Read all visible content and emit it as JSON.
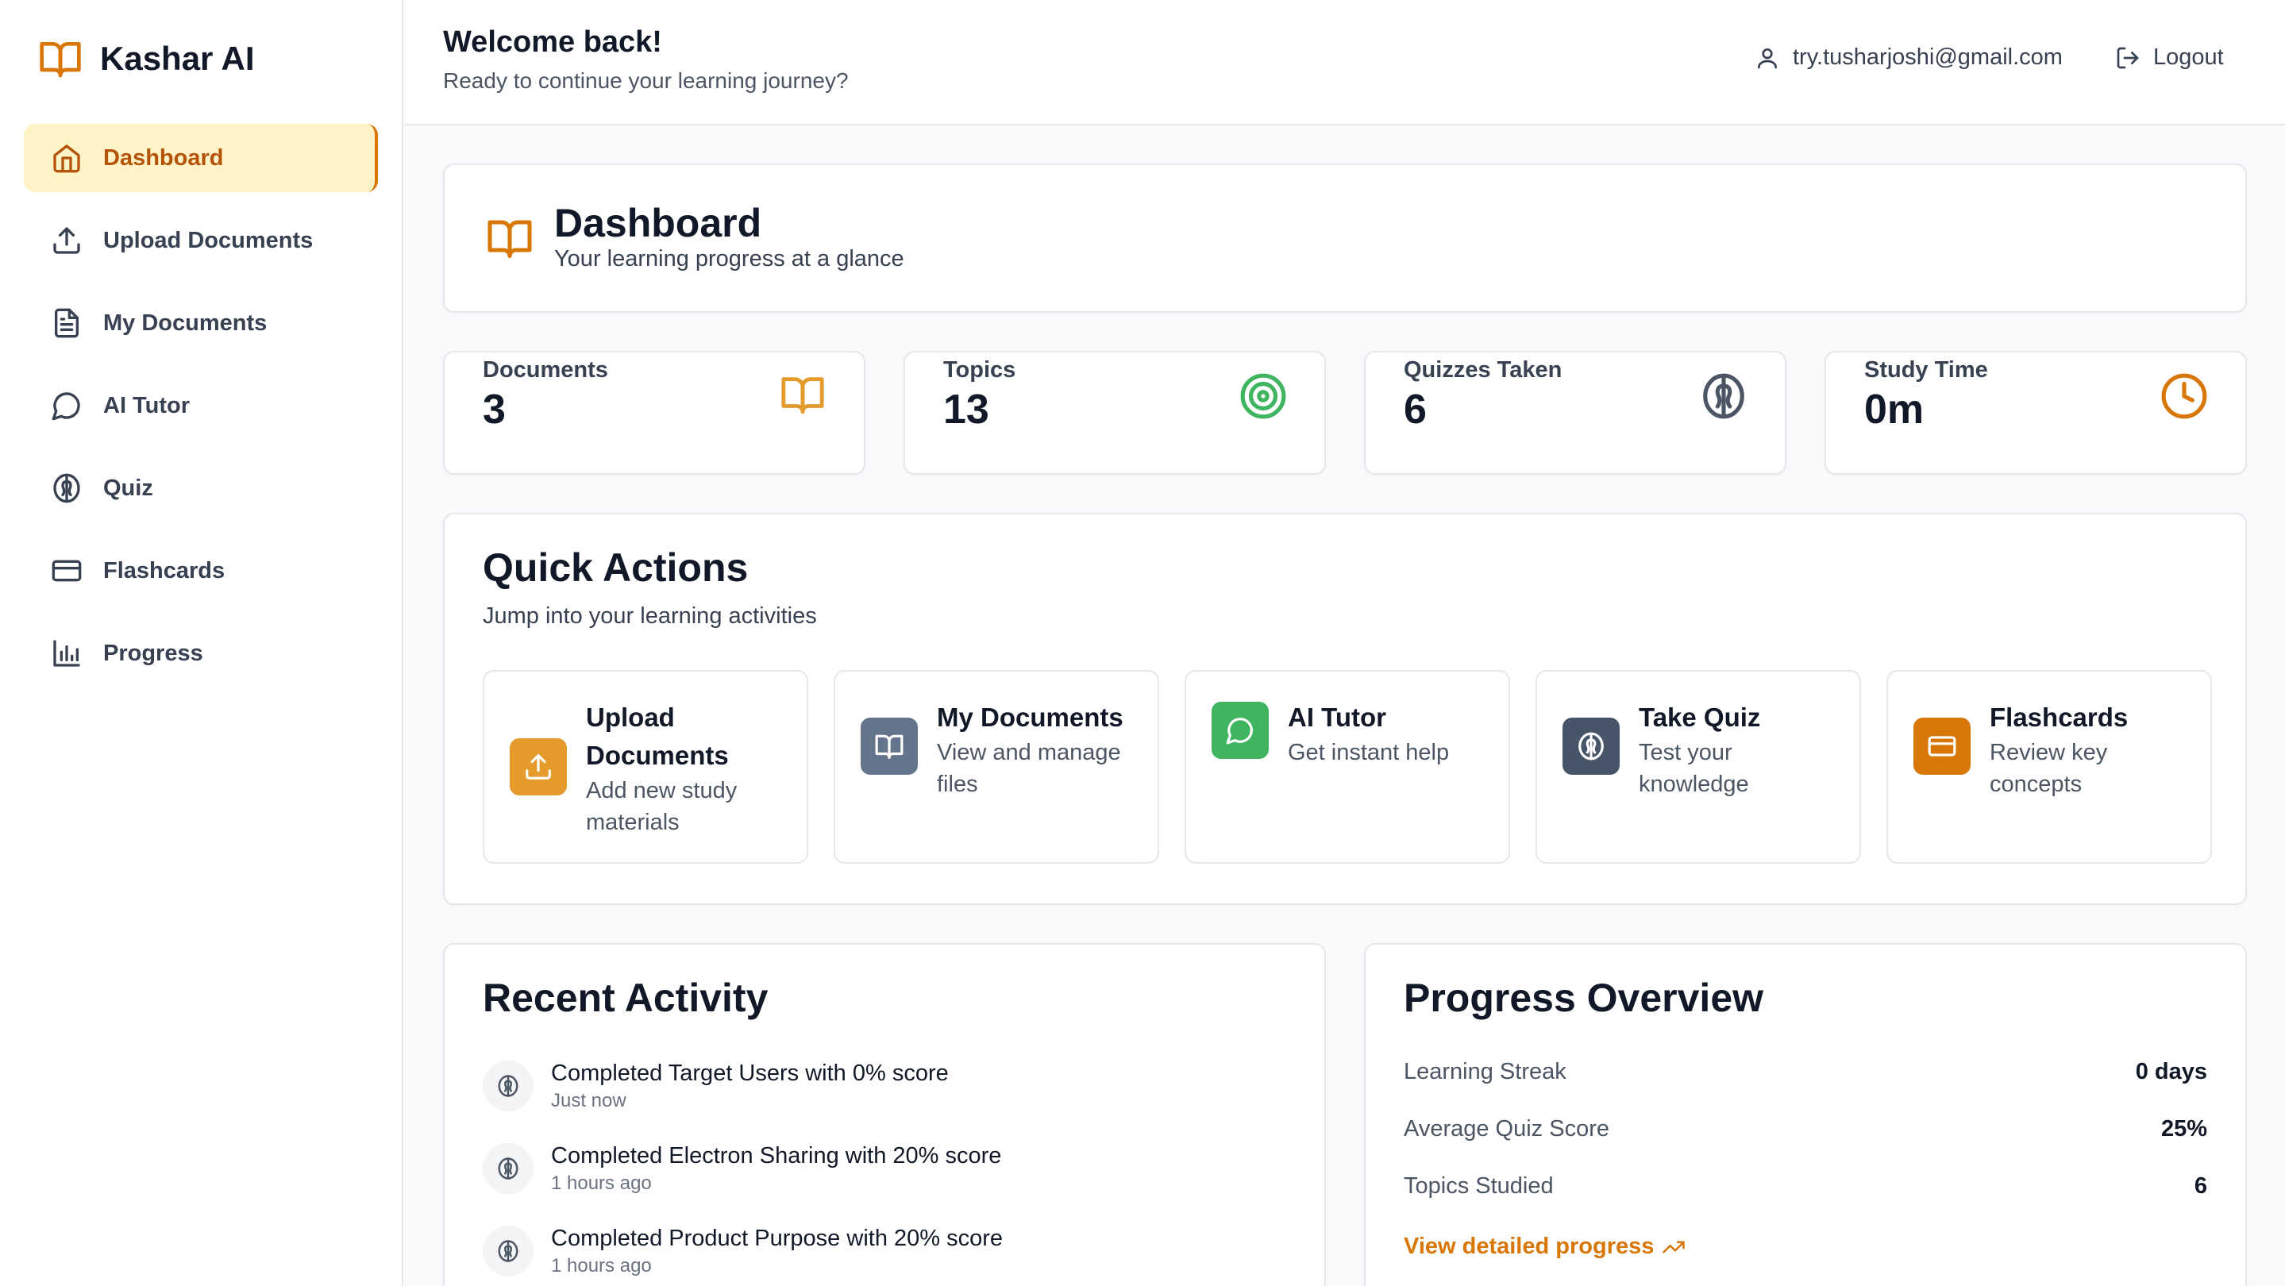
{
  "app": {
    "name": "Kashar AI"
  },
  "sidebar": {
    "items": [
      {
        "label": "Dashboard"
      },
      {
        "label": "Upload Documents"
      },
      {
        "label": "My Documents"
      },
      {
        "label": "AI Tutor"
      },
      {
        "label": "Quiz"
      },
      {
        "label": "Flashcards"
      },
      {
        "label": "Progress"
      }
    ]
  },
  "header": {
    "welcome": "Welcome back!",
    "subtitle": "Ready to continue your learning journey?",
    "user_email": "try.tusharjoshi@gmail.com",
    "logout_label": "Logout"
  },
  "dashboard": {
    "title": "Dashboard",
    "subtitle": "Your learning progress at a glance"
  },
  "stats": [
    {
      "label": "Documents",
      "value": "3",
      "icon": "book-icon",
      "color": "#e49b2c"
    },
    {
      "label": "Topics",
      "value": "13",
      "icon": "target-icon",
      "color": "#3fb560"
    },
    {
      "label": "Quizzes Taken",
      "value": "6",
      "icon": "brain-icon",
      "color": "#4b5563"
    },
    {
      "label": "Study Time",
      "value": "0m",
      "icon": "clock-icon",
      "color": "#d97706"
    }
  ],
  "quick_actions": {
    "title": "Quick Actions",
    "subtitle": "Jump into your learning activities",
    "items": [
      {
        "title_line1": "Upload",
        "title_line2": "Documents",
        "desc_line1": "Add new study",
        "desc_line2": "materials",
        "icon": "upload-icon",
        "color": "#e49b2c"
      },
      {
        "title_line1": "My Documents",
        "desc_line1": "View and manage",
        "desc_line2": "files",
        "icon": "book-icon",
        "color": "#64748b"
      },
      {
        "title_line1": "AI Tutor",
        "desc_line1": "Get instant help",
        "icon": "chat-icon",
        "color": "#3fb560"
      },
      {
        "title_line1": "Take Quiz",
        "desc_line1": "Test your",
        "desc_line2": "knowledge",
        "icon": "brain-icon",
        "color": "#475569"
      },
      {
        "title_line1": "Flashcards",
        "desc_line1": "Review key",
        "desc_line2": "concepts",
        "icon": "card-icon",
        "color": "#d97706"
      }
    ]
  },
  "recent_activity": {
    "title": "Recent Activity",
    "items": [
      {
        "text": "Completed Target Users with 0% score",
        "time": "Just now"
      },
      {
        "text": "Completed Electron Sharing with 20% score",
        "time": "1 hours ago"
      },
      {
        "text": "Completed Product Purpose with 20% score",
        "time": "1 hours ago"
      }
    ]
  },
  "progress_overview": {
    "title": "Progress Overview",
    "rows": [
      {
        "label": "Learning Streak",
        "value": "0 days"
      },
      {
        "label": "Average Quiz Score",
        "value": "25%"
      },
      {
        "label": "Topics Studied",
        "value": "6"
      }
    ],
    "link_label": "View detailed progress"
  }
}
